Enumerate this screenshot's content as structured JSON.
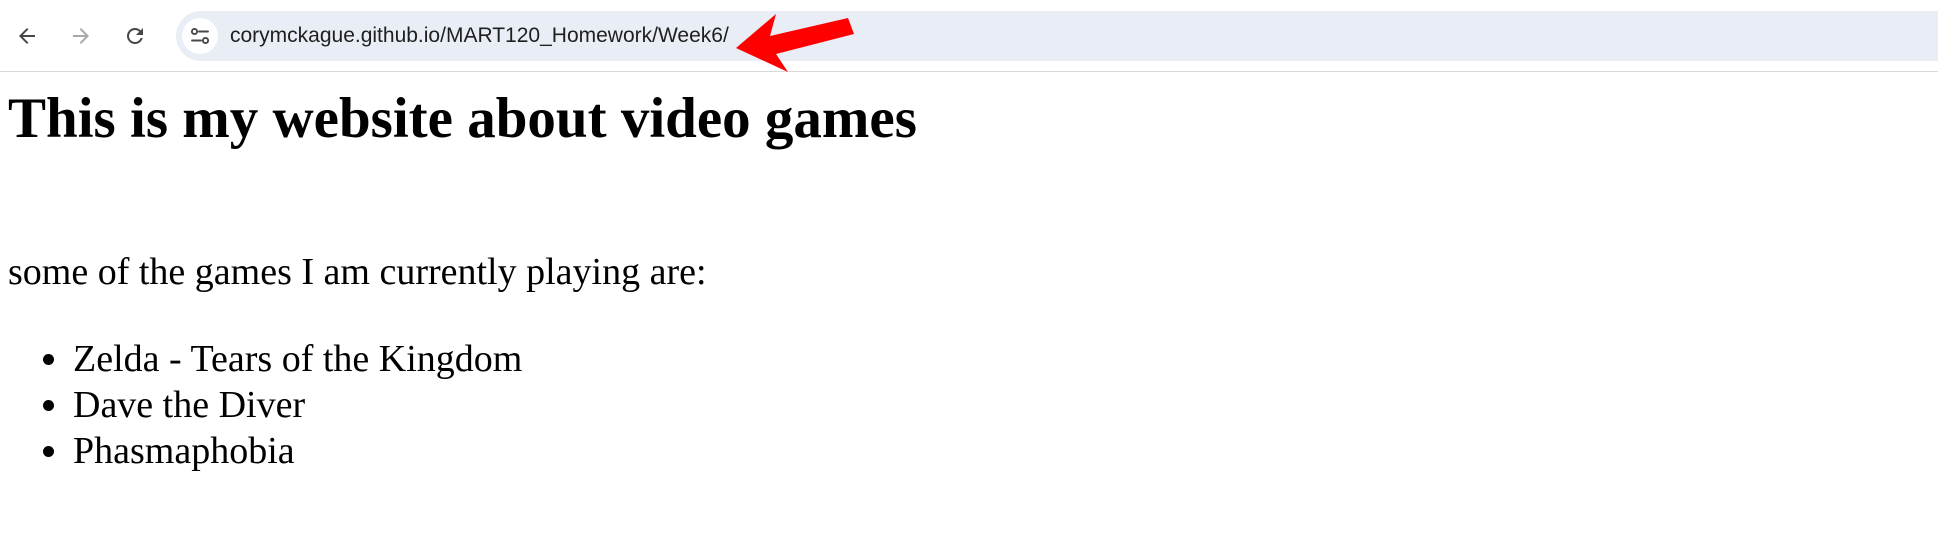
{
  "browser": {
    "url": "corymckague.github.io/MART120_Homework/Week6/",
    "icons": {
      "back": "arrow-left-icon",
      "forward": "arrow-right-icon",
      "reload": "reload-icon",
      "site_info": "tune-icon"
    },
    "annotation_color": "#ff0000"
  },
  "page": {
    "heading": "This is my website about video games",
    "intro": "some of the games I am currently playing are:",
    "games": [
      "Zelda - Tears of the Kingdom",
      "Dave the Diver",
      "Phasmaphobia"
    ]
  }
}
